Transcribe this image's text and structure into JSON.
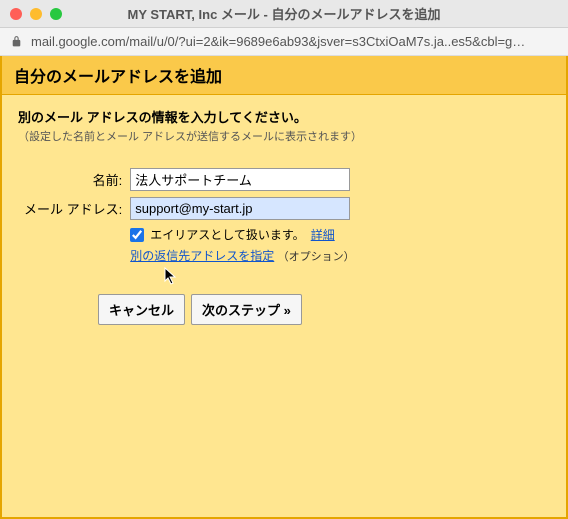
{
  "window": {
    "title": "MY START, Inc メール - 自分のメールアドレスを追加"
  },
  "addressbar": {
    "url": "mail.google.com/mail/u/0/?ui=2&ik=9689e6ab93&jsver=s3CtxiOaM7s.ja..es5&cbl=g…"
  },
  "page": {
    "title": "自分のメールアドレスを追加",
    "instruction_main": "別のメール アドレスの情報を入力してください。",
    "instruction_sub": "（設定した名前とメール アドレスが送信するメールに表示されます）"
  },
  "form": {
    "name_label": "名前:",
    "name_value": "法人サポートチーム",
    "email_label": "メール アドレス:",
    "email_value": "support@my-start.jp",
    "alias_checked": true,
    "alias_text": "エイリアスとして扱います。",
    "alias_link": "詳細",
    "reply_link": "別の返信先アドレスを指定",
    "reply_option": "（オプション）"
  },
  "buttons": {
    "cancel": "キャンセル",
    "next": "次のステップ »"
  }
}
